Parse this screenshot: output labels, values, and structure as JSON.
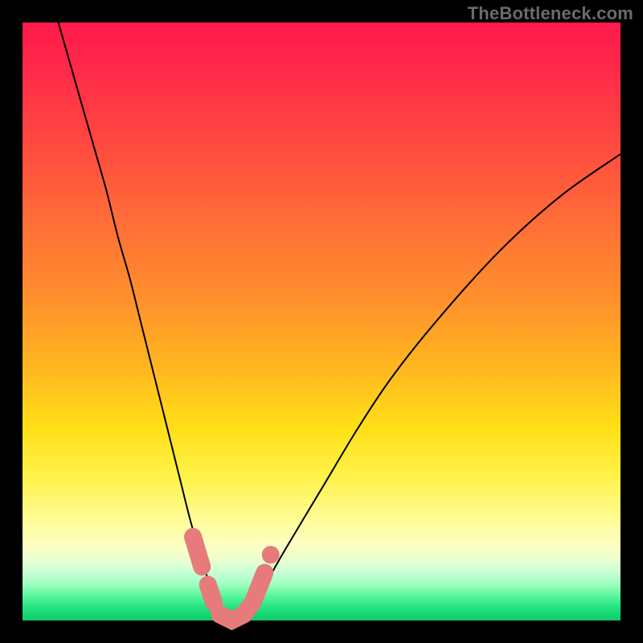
{
  "watermark": "TheBottleneck.com",
  "colors": {
    "pink_marker": "#e77a7a",
    "curve": "#000000"
  },
  "chart_data": {
    "type": "line",
    "title": "",
    "xlabel": "",
    "ylabel": "",
    "xlim": [
      0,
      100
    ],
    "ylim": [
      0,
      100
    ],
    "grid": false,
    "legend": false,
    "background": "rainbow-gradient (red top to green bottom)",
    "series": [
      {
        "name": "v-curve",
        "stroke": "#000000",
        "x": [
          6,
          8,
          10,
          12,
          14,
          16,
          18,
          20,
          22,
          24,
          26,
          28,
          30,
          32,
          33,
          34,
          36,
          38,
          40,
          44,
          50,
          56,
          62,
          70,
          80,
          90,
          100
        ],
        "y": [
          100,
          93,
          86,
          79,
          72,
          64,
          57,
          49,
          41,
          33,
          25,
          17,
          10,
          4,
          1,
          0,
          0,
          2,
          5,
          12,
          22,
          32,
          41,
          51,
          62,
          71,
          78
        ],
        "note": "V-shaped curve; minimum ~0 near x≈34–36, steep left branch from top-left corner, shallower right branch rising to upper-right."
      }
    ],
    "markers": [
      {
        "name": "bottom-pink-segments",
        "color": "#e77a7a",
        "shape": "thick rounded strokes and dots near curve minimum",
        "approx_points": [
          {
            "x": 28.5,
            "y": 14
          },
          {
            "x": 30,
            "y": 9
          },
          {
            "x": 31,
            "y": 6
          },
          {
            "x": 32,
            "y": 3
          },
          {
            "x": 33,
            "y": 1
          },
          {
            "x": 35,
            "y": 0
          },
          {
            "x": 37,
            "y": 1
          },
          {
            "x": 38.5,
            "y": 3
          },
          {
            "x": 40.5,
            "y": 8
          },
          {
            "x": 41.5,
            "y": 11
          }
        ]
      }
    ]
  }
}
